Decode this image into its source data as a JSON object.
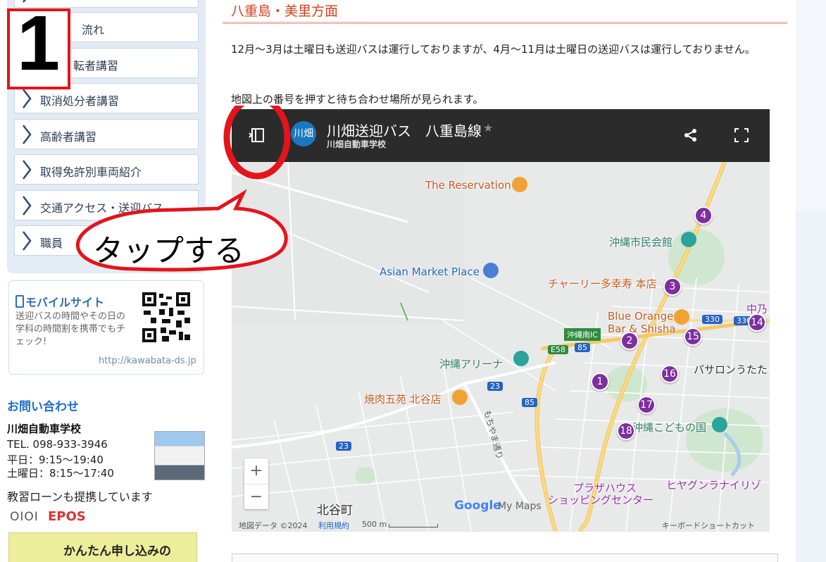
{
  "sidebar": {
    "menu_items": [
      {
        "label": ""
      },
      {
        "label": "流れ"
      },
      {
        "label": "転者講習"
      },
      {
        "label": "取消処分者講習"
      },
      {
        "label": "高齢者講習"
      },
      {
        "label": "取得免許別車両紹介"
      },
      {
        "label": "交通アクセス・送迎バス"
      },
      {
        "label": "職員"
      }
    ],
    "mobile": {
      "title": "モバイルサイト",
      "desc": "送迎バスの時間やその日の学科の時間割を携帯でもチェック!",
      "url": "http://kawabata-ds.jp"
    },
    "contact": {
      "title": "お問い合わせ",
      "school": "川畑自動車学校",
      "tel": "TEL. 098-933-3946",
      "weekday": "平日：9:15〜19:40",
      "saturday": "土曜日：8:15〜17:40",
      "loan": "教習ローンも提携しています",
      "logo1": "OIOI",
      "logo2": "EPOS",
      "apply": "かんたん申し込みの"
    }
  },
  "main": {
    "section_title": "八重島・美里方面",
    "paragraph": "12月〜3月は土曜日も送迎バスは運行しておりますが、4月〜11月は土曜日の送迎バスは運行しておりません。",
    "paragraph2": "地図上の番号を押すと待ち合わせ場所が見られます。"
  },
  "map": {
    "title": "川畑送迎バス　八重島線",
    "subtitle": "川畑自動車学校",
    "avatar": "川畑",
    "star": "★",
    "share_icon": "share-icon",
    "fullscreen_icon": "fullscreen-icon",
    "pois": [
      {
        "label": "The Reservation",
        "color": "#c65c20"
      },
      {
        "label": "沖縄市民会館",
        "color": "#2f7d6b"
      },
      {
        "label": "Asian Market Place",
        "color": "#1f66c1"
      },
      {
        "label": "チャーリー多幸寿 本店",
        "color": "#c65c20"
      },
      {
        "label": "Blue Orange",
        "color": "#c65c20"
      },
      {
        "label": "Bar & Shisha",
        "color": "#c65c20"
      },
      {
        "label": "沖縄アリーナ",
        "color": "#2f7d6b"
      },
      {
        "label": "焼肉五苑 北谷店",
        "color": "#c65c20"
      },
      {
        "label": "沖縄こどもの国",
        "color": "#2f7d6b"
      },
      {
        "label": "プラザハウス",
        "color": "#9c2fb0"
      },
      {
        "label": "ショッピングセンター",
        "color": "#9c2fb0"
      },
      {
        "label": "ヒヤグンラナイリゾ",
        "color": "#9c2fb0"
      },
      {
        "label": "北谷町",
        "color": "#333"
      },
      {
        "label": "パサロンうたた",
        "color": "#333"
      },
      {
        "label": "沖縄南IC",
        "color": "#fff"
      },
      {
        "label": "もちやま通り",
        "color": "#555"
      },
      {
        "label": "中乃",
        "color": "#9c2fb0"
      }
    ],
    "markers": [
      "1",
      "2",
      "3",
      "4",
      "14",
      "15",
      "16",
      "17",
      "18"
    ],
    "road_shields": [
      "330",
      "330",
      "85",
      "85",
      "23",
      "23",
      "E58"
    ],
    "zoom_in": "+",
    "zoom_out": "−",
    "footer": {
      "data": "地図データ ©2024",
      "terms": "利用規約",
      "scale": "500 m",
      "google": "Google",
      "mymaps": "My Maps",
      "shortcuts": "キーボードショートカット"
    }
  },
  "annotations": {
    "step_number": "1",
    "callout": "タップする",
    "highlight_color": "#e3141b"
  }
}
